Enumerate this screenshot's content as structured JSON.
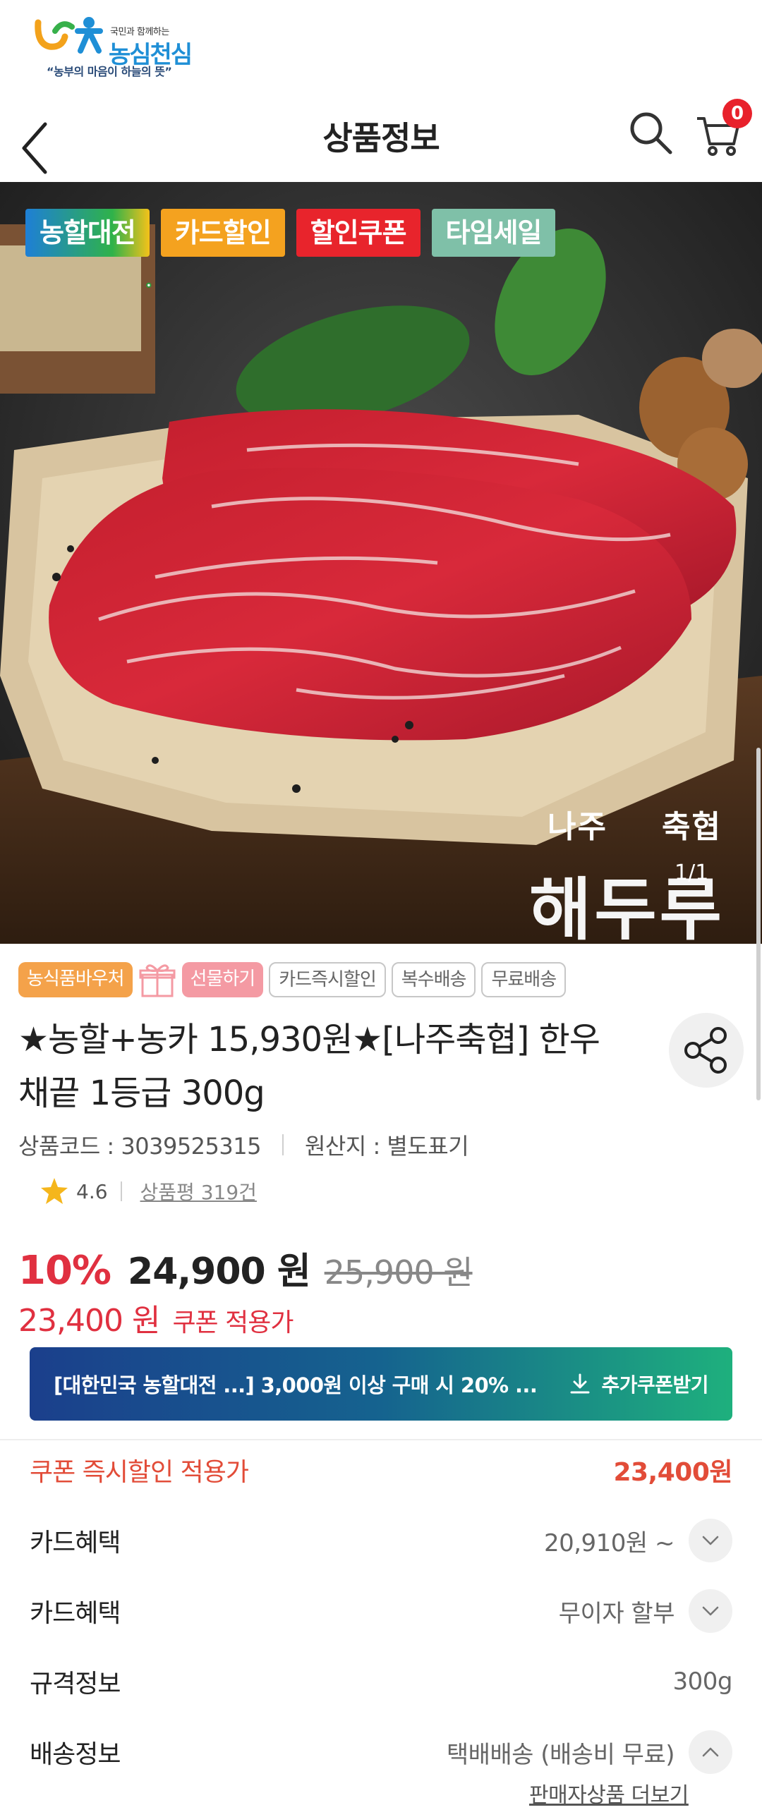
{
  "logo": {
    "tagline_small": "국민과 함께하는",
    "brand": "농심천심",
    "slogan": "“농부의 마음이 하늘의 뜻”"
  },
  "header": {
    "title": "상품정보",
    "cart_count": "0"
  },
  "hero": {
    "promo_tags": [
      "농할대전",
      "카드할인",
      "할인쿠폰",
      "타임세일"
    ],
    "brand_region": "나주",
    "brand_coop": "축협",
    "brand_main": "해두루",
    "image_counter": "1/1"
  },
  "chips": {
    "voucher": "농식품바우처",
    "gift": "선물하기",
    "card_instant": "카드즉시할인",
    "multi_ship": "복수배송",
    "free_ship": "무료배송"
  },
  "product": {
    "name": "★농할+농카 15,930원★[나주축협] 한우 채끝 1등급 300g",
    "code_label": "상품코드 : 3039525315",
    "origin_label": "원산지 : 별도표기",
    "rating": "4.6",
    "reviews": "상품평 319건"
  },
  "price": {
    "discount_rate": "10%",
    "sale_price": "24,900 원",
    "original_price": "25,900 원",
    "coupon_price": "23,400 원",
    "coupon_label": "쿠폰 적용가"
  },
  "coupon_banner": {
    "text": "[대한민국 농할대전 ...] 3,000원 이상 구매 시 20% ...",
    "action": "추가쿠폰받기"
  },
  "details": {
    "instant_label": "쿠폰 즉시할인 적용가",
    "instant_value": "23,400원",
    "card1_label": "카드혜택",
    "card1_value": "20,910원 ~",
    "card2_label": "카드혜택",
    "card2_value": "무이자 할부",
    "spec_label": "규격정보",
    "spec_value": "300g",
    "ship_label": "배송정보",
    "ship_value": "택배배송  (배송비 무료)",
    "seller_link": "판매자상품 더보기"
  },
  "colors": {
    "accent_red": "#e03040",
    "badge_red": "#e8212b",
    "coupon_gradient_start": "#1b3f8c",
    "coupon_gradient_end": "#1eb07d"
  }
}
